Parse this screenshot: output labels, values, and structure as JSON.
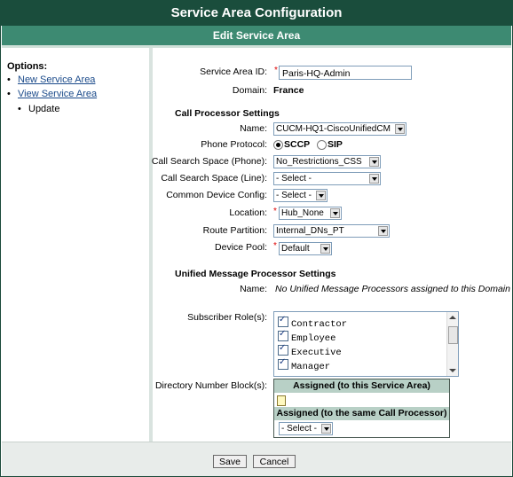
{
  "header": {
    "title": "Service Area Configuration",
    "subtitle": "Edit Service Area"
  },
  "sidebar": {
    "title": "Options:",
    "items": [
      {
        "label": "New Service Area",
        "link": true
      },
      {
        "label": "View Service Area",
        "link": true
      },
      {
        "label": "Update",
        "link": false
      }
    ]
  },
  "form": {
    "service_area_id": {
      "label": "Service Area ID:",
      "value": "Paris-HQ-Admin",
      "required_mark": "*"
    },
    "domain": {
      "label": "Domain:",
      "value": "France"
    },
    "call_processor": {
      "section_title": "Call Processor Settings",
      "name": {
        "label": "Name:",
        "value": "CUCM-HQ1-CiscoUnifiedCM"
      },
      "phone_protocol": {
        "label": "Phone Protocol:",
        "options": [
          "SCCP",
          "SIP"
        ],
        "selected": "SCCP"
      },
      "css_phone": {
        "label": "Call Search Space (Phone):",
        "value": "No_Restrictions_CSS"
      },
      "css_line": {
        "label": "Call Search Space (Line):",
        "value": "- Select -"
      },
      "common_device_config": {
        "label": "Common Device Config:",
        "value": "- Select -"
      },
      "location": {
        "label": "Location:",
        "value": "Hub_None",
        "required_mark": "*"
      },
      "route_partition": {
        "label": "Route Partition:",
        "value": "Internal_DNs_PT"
      },
      "device_pool": {
        "label": "Device Pool:",
        "value": "Default",
        "required_mark": "*"
      }
    },
    "ump": {
      "section_title": "Unified Message Processor Settings",
      "name": {
        "label": "Name:",
        "value": "No Unified Message Processors assigned to this Domain"
      }
    },
    "subscriber_roles": {
      "label": "Subscriber Role(s):",
      "items": [
        {
          "label": "Contractor",
          "checked": true
        },
        {
          "label": "Employee",
          "checked": true
        },
        {
          "label": "Executive",
          "checked": true
        },
        {
          "label": "Manager",
          "checked": true
        }
      ]
    },
    "dn_block": {
      "label": "Directory Number Block(s):",
      "assigned_header": "Assigned (to this Service Area)",
      "same_cp_header": "Assigned (to the same Call Processor)",
      "select_value": "- Select -",
      "icon": "document-icon"
    }
  },
  "buttons": {
    "save": "Save",
    "cancel": "Cancel"
  },
  "colors": {
    "title_bar": "#1a4d3c",
    "sub_bar": "#3d8a72",
    "link": "#1a4a8a",
    "required": "#dd0000"
  }
}
